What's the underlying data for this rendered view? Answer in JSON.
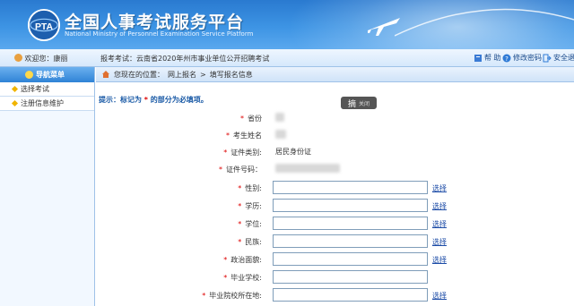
{
  "banner": {
    "title": "全国人事考试服务平台",
    "subtitle": "National Ministry of Personnel Examination Service Platform",
    "logo_text": "PTA"
  },
  "topbar": {
    "welcome_label": "欢迎您：",
    "user_name": "康丽",
    "exam_label": "报考考试：",
    "exam_name": "云南省2020年州市事业单位公开招聘考试",
    "help": "帮 助",
    "change_password": "修改密码",
    "logout": "安全退出"
  },
  "sidebar": {
    "header": "导航菜单",
    "items": [
      {
        "label": "选择考试"
      },
      {
        "label": "注册信息维护"
      }
    ]
  },
  "breadcrumb": {
    "prefix": "您现在的位置：",
    "level1": "网上报名",
    "separator": ">",
    "level2": "填写报名信息"
  },
  "tip": {
    "text1": "提示：标记为 ",
    "star": "*",
    "text2": " 的部分为必填项。"
  },
  "tooltip": {
    "main": "摘",
    "close": "关闭"
  },
  "form": {
    "select_link": "选择",
    "fields": [
      {
        "label": "省份",
        "required": true,
        "type": "blurred"
      },
      {
        "label": "考生姓名",
        "required": true,
        "type": "blurred"
      },
      {
        "label": "证件类别:",
        "required": true,
        "type": "text",
        "value": "居民身份证"
      },
      {
        "label": "证件号码：",
        "required": true,
        "type": "blurred"
      },
      {
        "label": "性别:",
        "required": true,
        "type": "input",
        "value": "",
        "select": true
      },
      {
        "label": "学历:",
        "required": true,
        "type": "input",
        "value": "",
        "select": true
      },
      {
        "label": "学位:",
        "required": true,
        "type": "input",
        "value": "",
        "select": true
      },
      {
        "label": "民族:",
        "required": true,
        "type": "input",
        "value": "",
        "select": true
      },
      {
        "label": "政治面貌:",
        "required": true,
        "type": "input",
        "value": "",
        "select": true
      },
      {
        "label": "毕业学校:",
        "required": true,
        "type": "input",
        "value": "",
        "select": false
      },
      {
        "label": "毕业院校所在地:",
        "required": true,
        "type": "input",
        "value": "",
        "select": true
      }
    ]
  },
  "colors": {
    "banner": "#3d94e4",
    "link": "#1a4aa6",
    "required": "#dd0000",
    "tip": "#1a5aa6"
  }
}
